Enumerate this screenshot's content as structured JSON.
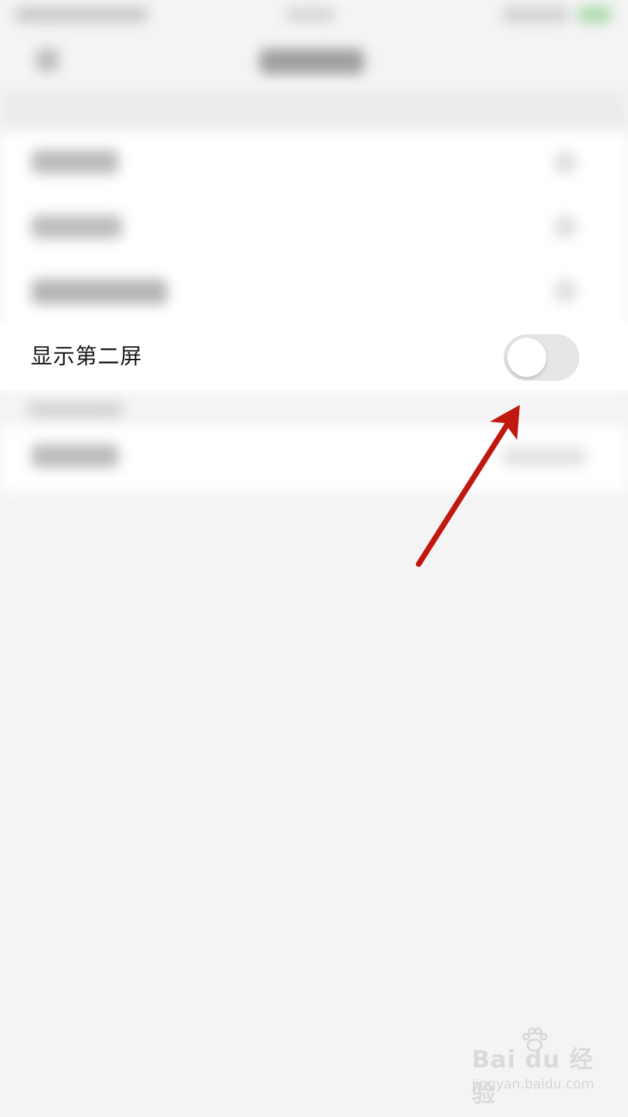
{
  "setting": {
    "label": "显示第二屏",
    "toggle_state": "off"
  },
  "colors": {
    "background": "#f4f4f4",
    "card": "#ffffff",
    "toggle_track_off": "#e6e6e6",
    "arrow": "#c0170f"
  },
  "watermark": {
    "logo": "Bai du 经验",
    "url": "jingyan.baidu.com"
  }
}
